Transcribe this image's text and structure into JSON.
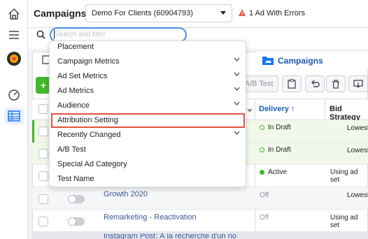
{
  "header": {
    "title": "Campaigns",
    "account_selector": "Demo For Clients (60904793)",
    "error_text": "1 Ad With Errors"
  },
  "search": {
    "placeholder": "Search and filter"
  },
  "tabs": {
    "campaigns_label": "Campaigns"
  },
  "toolbar": {
    "ab_test_label": "A/B Test"
  },
  "table": {
    "headers": {
      "delivery": "Delivery ↑",
      "bid_strategy": "Bid Strategy"
    },
    "rows": [
      {
        "name": "",
        "delivery": "In Draft",
        "bid": "Lowest"
      },
      {
        "name": "",
        "delivery": "In Draft",
        "bid": "Lowest"
      },
      {
        "name": "",
        "delivery": "Active",
        "bid": "Using ad set"
      },
      {
        "name": "Growth 2020",
        "delivery": "Off",
        "bid": "Lowest"
      },
      {
        "name": "Remarketing - Reactivation",
        "delivery": "Off",
        "bid": "Using ad set"
      },
      {
        "name": "Instagram Post: À la recherche d'un nouveau",
        "delivery": "",
        "bid": ""
      }
    ]
  },
  "dropdown": {
    "items": [
      {
        "label": "Placement",
        "has_submenu": false
      },
      {
        "label": "Campaign Metrics",
        "has_submenu": true
      },
      {
        "label": "Ad Set Metrics",
        "has_submenu": true
      },
      {
        "label": "Ad Metrics",
        "has_submenu": true
      },
      {
        "label": "Audience",
        "has_submenu": true
      },
      {
        "label": "Attribution Setting",
        "has_submenu": false,
        "highlighted": true
      },
      {
        "label": "Recently Changed",
        "has_submenu": true
      },
      {
        "label": "A/B Test",
        "has_submenu": false
      },
      {
        "label": "Special Ad Category",
        "has_submenu": false
      },
      {
        "label": "Test Name",
        "has_submenu": false
      }
    ]
  },
  "colors": {
    "accent": "#1877f2",
    "error": "#e0533d",
    "success": "#42b72a",
    "highlight_outline": "#e0533d"
  },
  "icons": [
    "home-icon",
    "menu-icon",
    "avatar",
    "dashboard-icon",
    "table-icon",
    "search-icon",
    "warning-icon",
    "chevron-down-icon",
    "clipboard-icon",
    "undo-icon",
    "trash-icon",
    "export-icon",
    "folder-icon"
  ]
}
